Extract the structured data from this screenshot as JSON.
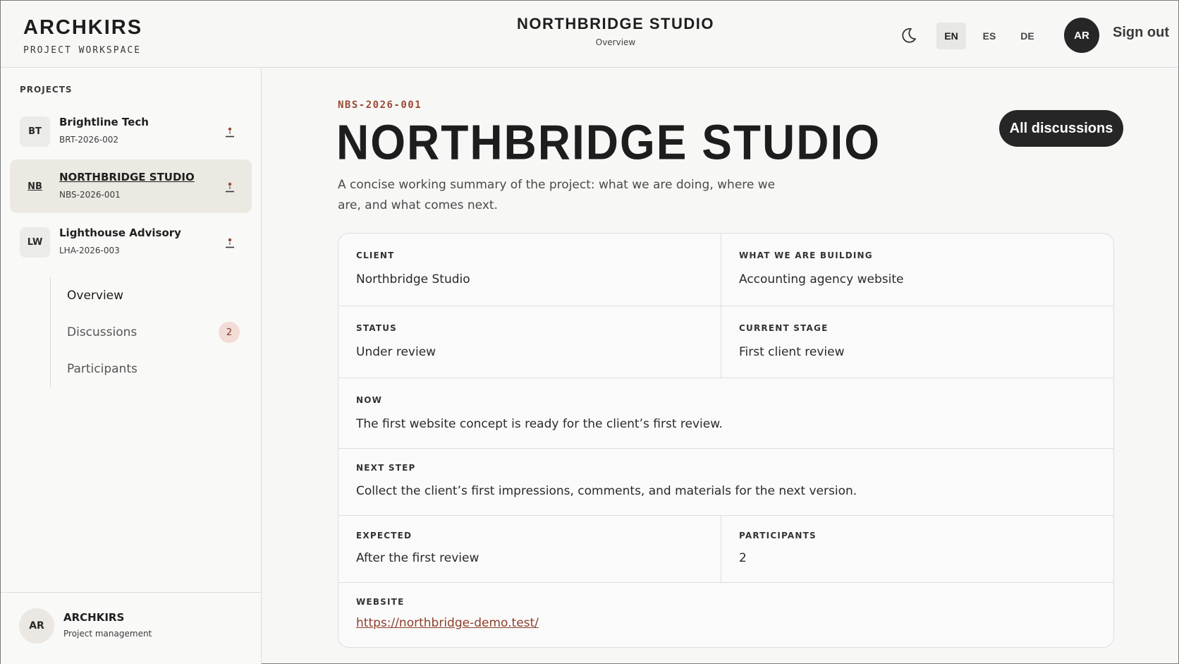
{
  "header": {
    "brand_name": "ARCHKIRS",
    "brand_sub": "PROJECT WORKSPACE",
    "title": "NORTHBRIDGE STUDIO",
    "subtitle": "Overview",
    "theme_icon": "moon-icon",
    "languages": [
      "EN",
      "ES",
      "DE"
    ],
    "active_language": "EN",
    "user_initials": "AR",
    "sign_out": "Sign out"
  },
  "sidebar": {
    "label": "PROJECTS",
    "projects": [
      {
        "initials": "BT",
        "name": "Brightline Tech",
        "code": "BRT-2026-002",
        "active": false
      },
      {
        "initials": "NB",
        "name": "NORTHBRIDGE STUDIO",
        "code": "NBS-2026-001",
        "active": true
      },
      {
        "initials": "LW",
        "name": "Lighthouse Advisory",
        "code": "LHA-2026-003",
        "active": false
      }
    ],
    "subnav": [
      {
        "label": "Overview",
        "active": true
      },
      {
        "label": "Discussions",
        "count": "2"
      },
      {
        "label": "Participants"
      }
    ],
    "footer": {
      "initials": "AR",
      "name": "ARCHKIRS",
      "role": "Project management"
    }
  },
  "main": {
    "code": "NBS-2026-001",
    "title": "NORTHBRIDGE STUDIO",
    "description": "A concise working summary of the project: what we are doing, where we are, and what comes next.",
    "discussions_button": "All discussions",
    "fields": {
      "client": {
        "label": "CLIENT",
        "value": "Northbridge Studio"
      },
      "building": {
        "label": "WHAT WE ARE BUILDING",
        "value": "Accounting agency website"
      },
      "status": {
        "label": "STATUS",
        "value": "Under review"
      },
      "stage": {
        "label": "CURRENT STAGE",
        "value": "First client review"
      },
      "now": {
        "label": "NOW",
        "value": "The first website concept is ready for the client’s first review."
      },
      "next": {
        "label": "NEXT STEP",
        "value": "Collect the client’s first impressions, comments, and materials for the next version."
      },
      "expected": {
        "label": "EXPECTED",
        "value": "After the first review"
      },
      "participants": {
        "label": "PARTICIPANTS",
        "value": "2"
      },
      "website": {
        "label": "WEBSITE",
        "value": "https://northbridge-demo.test/"
      }
    }
  },
  "colors": {
    "accent": "#9a4a32",
    "dark": "#262626",
    "active_bg": "#ece8e2",
    "badge_bg": "#f2dcd5"
  }
}
